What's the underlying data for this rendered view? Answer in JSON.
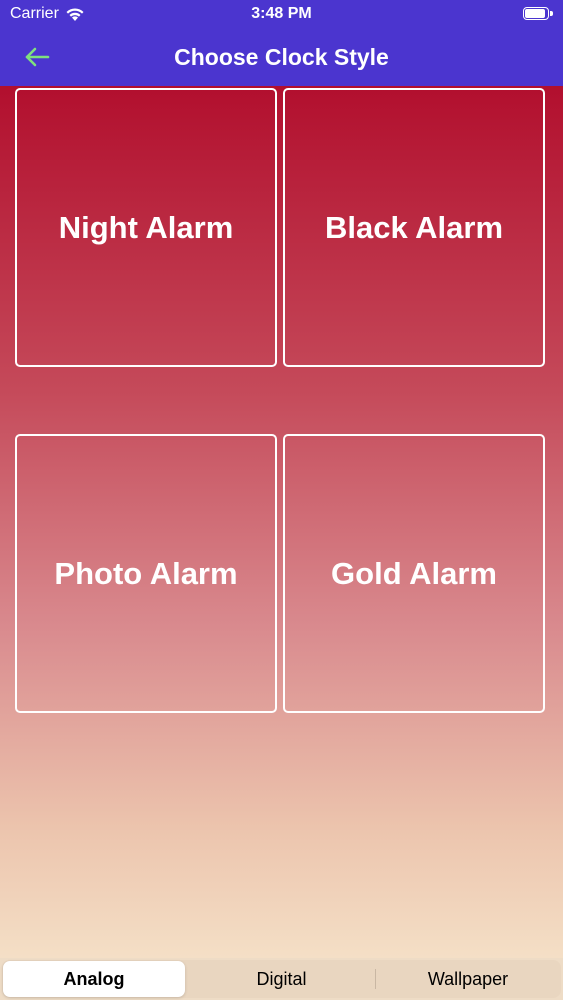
{
  "status_bar": {
    "carrier": "Carrier",
    "time": "3:48 PM",
    "icons": [
      "wifi-icon",
      "battery-icon"
    ]
  },
  "nav": {
    "title": "Choose Clock Style",
    "back_icon": "arrow-left-icon",
    "back_icon_color": "#7fe07f"
  },
  "colors": {
    "header": "#4b35cf",
    "gradient_top": "#b20f2e",
    "gradient_bottom": "#f4dfc6",
    "card_border": "#ffffff"
  },
  "cards": [
    {
      "label": "Night Alarm"
    },
    {
      "label": "Black Alarm"
    },
    {
      "label": "Photo Alarm"
    },
    {
      "label": "Gold Alarm"
    }
  ],
  "tabs": [
    {
      "label": "Analog",
      "selected": true
    },
    {
      "label": "Digital",
      "selected": false
    },
    {
      "label": "Wallpaper",
      "selected": false
    }
  ]
}
